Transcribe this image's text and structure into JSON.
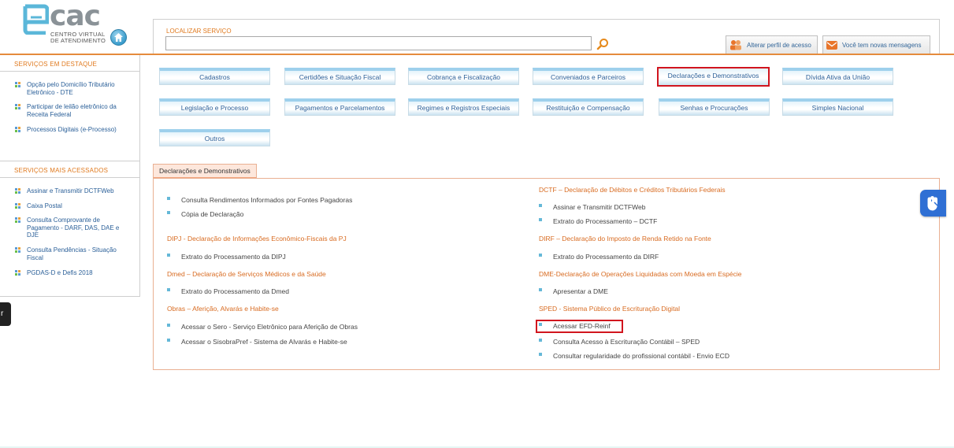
{
  "brand": {
    "logo_text": "cac",
    "logo_sub_line1": "CENTRO VIRTUAL",
    "logo_sub_line2": "DE ATENDIMENTO"
  },
  "search": {
    "label": "LOCALIZAR SERVIÇO",
    "value": "",
    "placeholder": ""
  },
  "top_buttons": {
    "perfil": "Alterar perfil de acesso",
    "mensagens": "Você tem novas mensagens"
  },
  "sidebar": {
    "destaque_header": "SERVIÇOS EM DESTAQUE",
    "destaque_items": [
      {
        "label": "Opção pelo Domicílio Tributário Eletrônico - DTE"
      },
      {
        "label": "Participar de leilão eletrônico da Receita Federal"
      },
      {
        "label": "Processos Digitais (e-Processo)"
      }
    ],
    "acessados_header": "SERVIÇOS MAIS ACESSADOS",
    "acessados_items": [
      {
        "label": "Assinar e Transmitir DCTFWeb"
      },
      {
        "label": "Caixa Postal"
      },
      {
        "label": "Consulta Comprovante de Pagamento - DARF, DAS, DAE e DJE"
      },
      {
        "label": "Consulta Pendências - Situação Fiscal"
      },
      {
        "label": "PGDAS-D e Defis 2018"
      }
    ]
  },
  "dark_tab": {
    "label": "r"
  },
  "categories": [
    {
      "label": "Cadastros"
    },
    {
      "label": "Certidões e Situação Fiscal"
    },
    {
      "label": "Cobrança e Fiscalização"
    },
    {
      "label": "Conveniados e Parceiros"
    },
    {
      "label": "Declarações e Demonstrativos",
      "selected": true
    },
    {
      "label": "Dívida Ativa da União"
    },
    {
      "label": "Legislação e Processo"
    },
    {
      "label": "Pagamentos e Parcelamentos"
    },
    {
      "label": "Regimes e Registros Especiais"
    },
    {
      "label": "Restituição e Compensação"
    },
    {
      "label": "Senhas e Procurações"
    },
    {
      "label": "Simples Nacional"
    },
    {
      "label": "Outros"
    }
  ],
  "panel": {
    "tab_label": "Declarações e Demonstrativos",
    "left": {
      "general_items": [
        "Consulta Rendimentos Informados por Fontes Pagadoras",
        "Cópia de Declaração"
      ],
      "dipj_title": "DIPJ - Declaração de Informações Econômico-Fiscais da PJ",
      "dipj_items": [
        "Extrato do Processamento da DIPJ"
      ],
      "dmed_title": "Dmed – Declaração de Serviços Médicos e da Saúde",
      "dmed_items": [
        "Extrato do Processamento da Dmed"
      ],
      "obras_title": "Obras – Aferição, Alvarás e Habite-se",
      "obras_items": [
        "Acessar o Sero - Serviço Eletrônico para Aferição de Obras",
        "Acessar o SisobraPref - Sistema de Alvarás e Habite-se"
      ]
    },
    "right": {
      "dctf_title": "DCTF – Declaração de Débitos e Créditos Tributários Federais",
      "dctf_items": [
        "Assinar e Transmitir DCTFWeb",
        "Extrato do Processamento – DCTF"
      ],
      "dirf_title": "DIRF – Declaração do Imposto de Renda Retido na Fonte",
      "dirf_items": [
        "Extrato do Processamento da DIRF"
      ],
      "dme_title": "DME-Declaração de Operações Liquidadas com Moeda em Espécie",
      "dme_items": [
        "Apresentar a DME"
      ],
      "sped_title": "SPED - Sistema Público de Escrituração Digital",
      "sped_items": [
        "Acessar EFD-Reinf",
        "Consulta Acesso à Escrituração Contábil – SPED",
        "Consultar regularidade do profissional contábil - Envio ECD"
      ]
    }
  },
  "colors": {
    "accent_orange": "#e07a1f",
    "link_blue": "#2a5f98",
    "highlight_red": "#d1151e"
  }
}
